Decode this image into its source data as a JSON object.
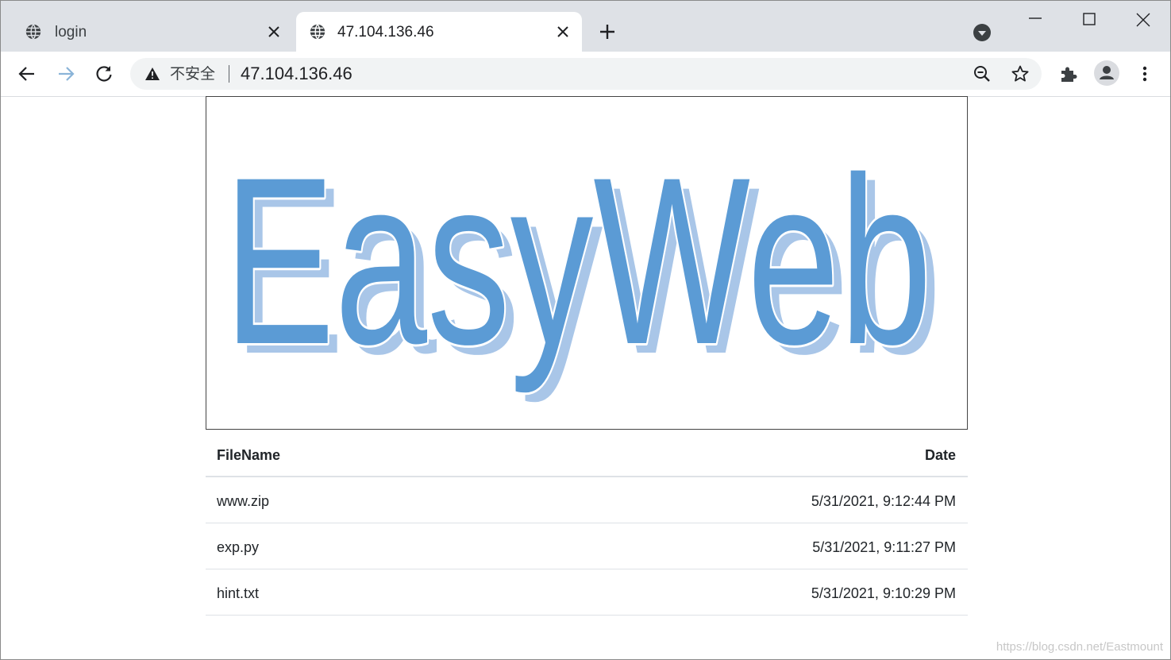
{
  "tabs": [
    {
      "title": "login",
      "icon": "globe-icon"
    },
    {
      "title": "47.104.136.46",
      "icon": "globe-icon",
      "active": true
    }
  ],
  "omnibox": {
    "security_label": "不安全",
    "url": "47.104.136.46"
  },
  "logo": {
    "text": "EasyWeb",
    "color": "#5b9bd5",
    "shadow_color": "#a9c6e8"
  },
  "table": {
    "headers": {
      "name": "FileName",
      "date": "Date"
    },
    "rows": [
      {
        "name": "www.zip",
        "date": "5/31/2021, 9:12:44 PM"
      },
      {
        "name": "exp.py",
        "date": "5/31/2021, 9:11:27 PM"
      },
      {
        "name": "hint.txt",
        "date": "5/31/2021, 9:10:29 PM"
      }
    ]
  },
  "watermark": "https://blog.csdn.net/Eastmount"
}
